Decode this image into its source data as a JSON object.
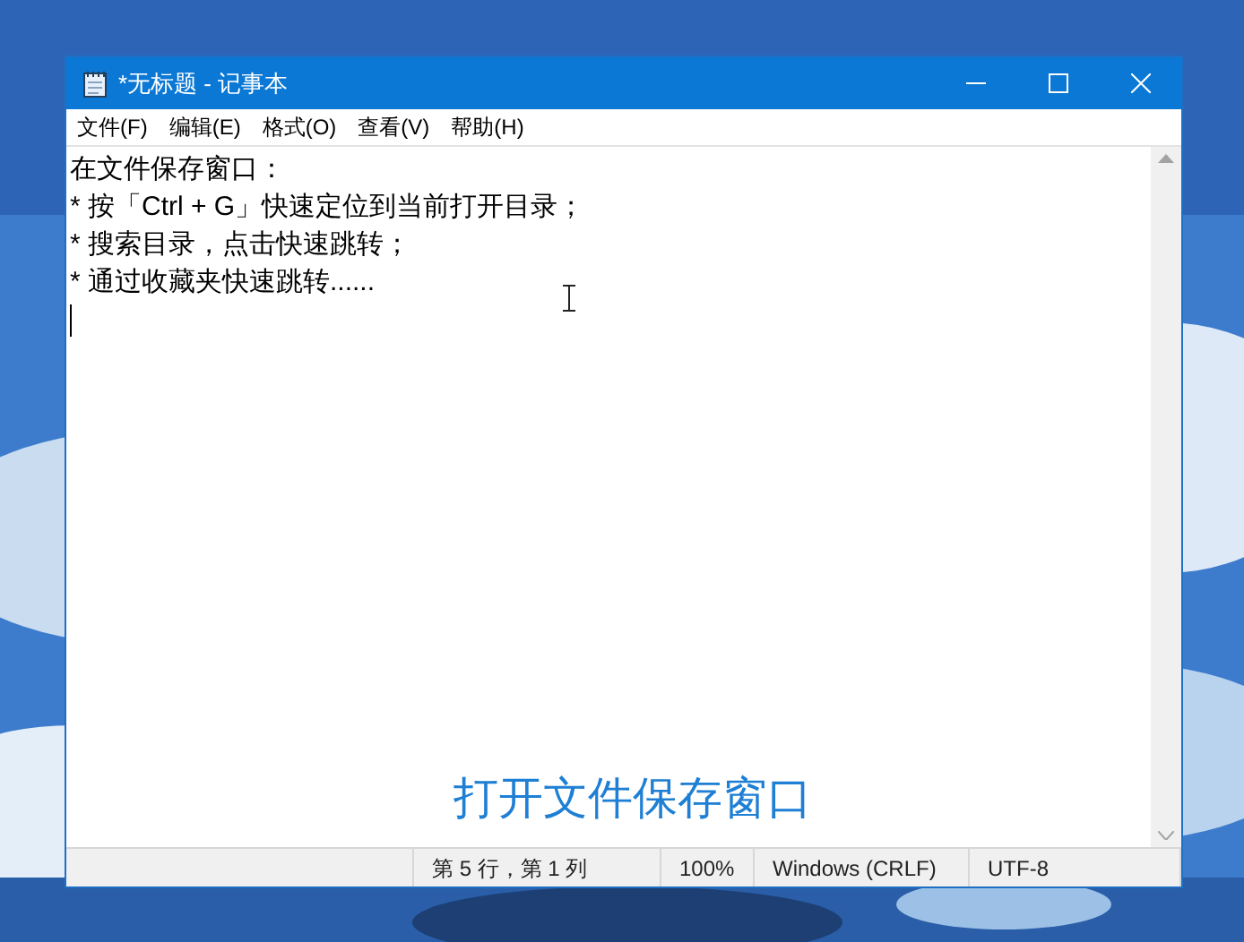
{
  "window": {
    "title": "*无标题 - 记事本"
  },
  "menu": [
    "文件(F)",
    "编辑(E)",
    "格式(O)",
    "查看(V)",
    "帮助(H)"
  ],
  "editor": {
    "lines": [
      "在文件保存窗口：",
      "* 按「Ctrl + G」快速定位到当前打开目录；",
      "* 搜索目录，点击快速跳转；",
      "* 通过收藏夹快速跳转......"
    ]
  },
  "caption": "打开文件保存窗口",
  "status_bar": [
    "第 5 行，第 1 列",
    "100%",
    "Windows (CRLF)",
    "UTF-8"
  ]
}
